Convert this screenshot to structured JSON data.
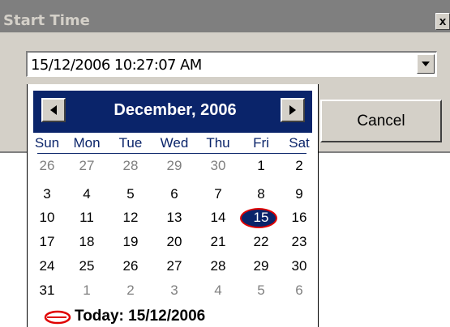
{
  "dialog": {
    "title": "Start Time",
    "close_label": "x",
    "datetime_value": "15/12/2006 10:27:07 AM",
    "cancel_label": "Cancel"
  },
  "calendar": {
    "month_title": "December, 2006",
    "prev_glyph": "◄",
    "next_glyph": "►",
    "weekdays": [
      "Sun",
      "Mon",
      "Tue",
      "Wed",
      "Thu",
      "Fri",
      "Sat"
    ],
    "weeks": [
      [
        "26",
        "27",
        "28",
        "29",
        "30",
        "1",
        "2"
      ],
      [
        "3",
        "4",
        "5",
        "6",
        "7",
        "8",
        "9"
      ],
      [
        "10",
        "11",
        "12",
        "13",
        "14",
        "15",
        "16"
      ],
      [
        "17",
        "18",
        "19",
        "20",
        "21",
        "22",
        "23"
      ],
      [
        "24",
        "25",
        "26",
        "27",
        "28",
        "29",
        "30"
      ],
      [
        "31",
        "1",
        "2",
        "3",
        "4",
        "5",
        "6"
      ]
    ],
    "selected_day": "15",
    "today_text": "Today: 15/12/2006"
  },
  "colors": {
    "header_bg": "#0a246a",
    "dialog_bg": "#d4d0c8",
    "highlight_ring": "#e00000"
  }
}
